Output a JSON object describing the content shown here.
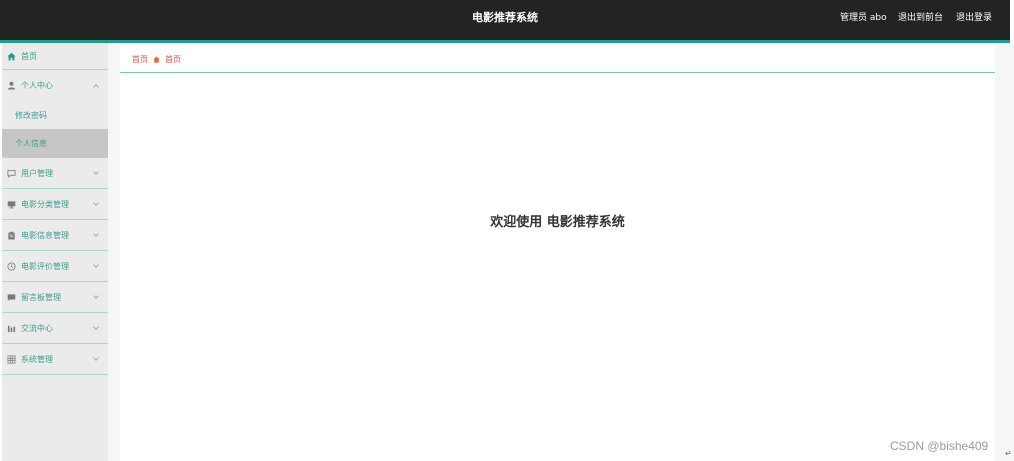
{
  "header": {
    "title": "电影推荐系统",
    "user_label": "管理员 abo",
    "back_to_front": "退出到前台",
    "logout": "退出登录"
  },
  "colors": {
    "header_bg": "#232323",
    "accent": "#1f9e89",
    "sidebar_bg": "#ebebeb",
    "sidebar_active_bg": "#c6c6c6",
    "menu_text": "#3a9d8c",
    "breadcrumb_text": "#d9534f"
  },
  "sidebar": {
    "items": [
      {
        "label": "首页",
        "icon": "home-icon"
      },
      {
        "label": "个人中心",
        "icon": "user-icon",
        "expanded": true,
        "children": [
          {
            "label": "修改密码",
            "active": false
          },
          {
            "label": "个人信息",
            "active": true
          }
        ]
      },
      {
        "label": "用户管理",
        "icon": "chat-icon"
      },
      {
        "label": "电影分类管理",
        "icon": "monitor-icon"
      },
      {
        "label": "电影信息管理",
        "icon": "clipboard-icon"
      },
      {
        "label": "电影评价管理",
        "icon": "clock-icon"
      },
      {
        "label": "留言板管理",
        "icon": "message-icon"
      },
      {
        "label": "交流中心",
        "icon": "bar-chart-icon"
      },
      {
        "label": "系统管理",
        "icon": "grid-icon"
      }
    ]
  },
  "breadcrumb": {
    "items": [
      "首页",
      "首页"
    ],
    "separator_icon": "home-icon"
  },
  "main": {
    "welcome": "欢迎使用 电影推荐系统"
  },
  "watermark": "CSDN @bishe409",
  "corner_icon": "return-icon"
}
